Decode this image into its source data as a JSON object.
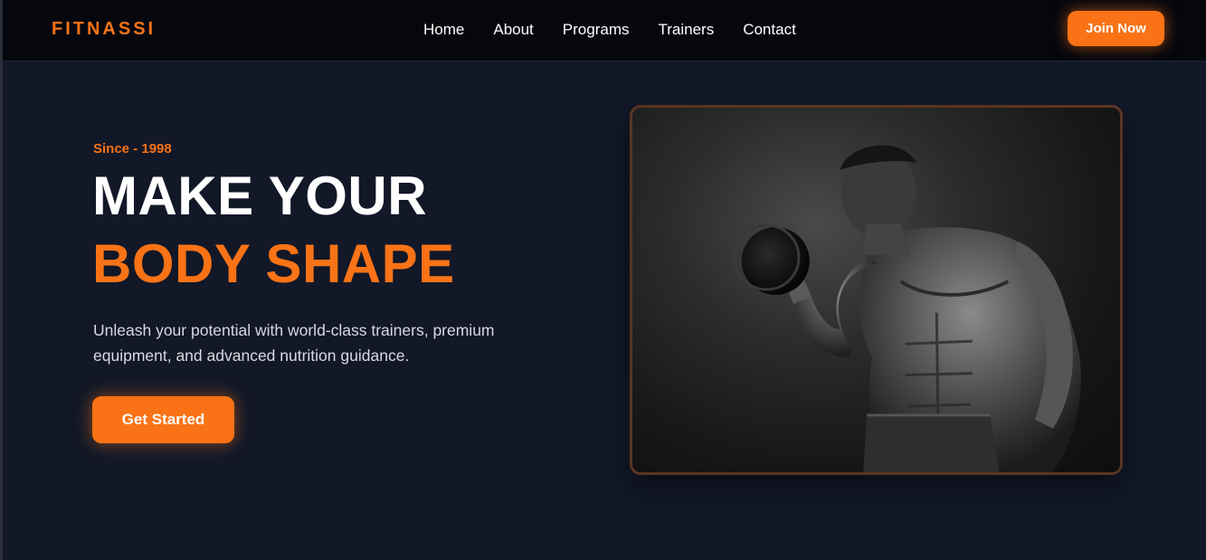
{
  "brand": {
    "logo": "FITNASSI",
    "accent": "#f97316"
  },
  "nav": {
    "items": [
      {
        "label": "Home"
      },
      {
        "label": "About"
      },
      {
        "label": "Programs"
      },
      {
        "label": "Trainers"
      },
      {
        "label": "Contact"
      }
    ],
    "cta_label": "Join Now"
  },
  "hero": {
    "since": "Since - 1998",
    "headline_line1": "MAKE YOUR",
    "headline_line2": "BODY SHAPE",
    "tagline": "Unleash your potential with world-class trainers, premium equipment, and advanced nutrition guidance.",
    "cta_label": "Get Started",
    "image_subject": "muscular man lifting dumbbell (black and white photo)"
  },
  "colors": {
    "background": "#121828",
    "header": "#05070d",
    "photo_border": "#5a3522"
  }
}
